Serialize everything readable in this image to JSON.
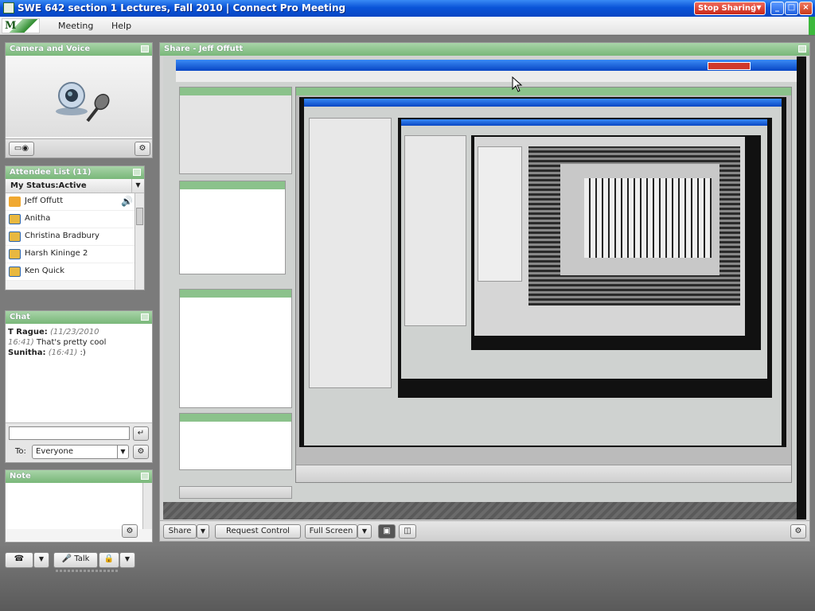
{
  "window": {
    "title": "SWE 642 section 1 Lectures, Fall 2010  |  Connect Pro Meeting",
    "stop_sharing_label": "Stop Sharing",
    "minimize": "_",
    "maximize": "□",
    "close": "×"
  },
  "menu": {
    "logo": "M",
    "items": [
      "Meeting",
      "Help"
    ]
  },
  "camera_pod": {
    "title": "Camera and Voice"
  },
  "attendee_pod": {
    "title": "Attendee List (11)",
    "status_label": "My Status:Active",
    "attendees": [
      {
        "name": "Jeff Offutt",
        "role": "host",
        "speaking": true
      },
      {
        "name": "Anitha",
        "role": "participant"
      },
      {
        "name": "Christina Bradbury",
        "role": "participant"
      },
      {
        "name": "Harsh Kininge 2",
        "role": "participant"
      },
      {
        "name": "Ken Quick",
        "role": "participant"
      }
    ]
  },
  "chat_pod": {
    "title": "Chat",
    "messages": [
      {
        "name": "T Rague:",
        "timestamp": "(11/23/2010",
        "timestamp2": "16:41)",
        "text": "That's pretty cool"
      },
      {
        "name": "Sunitha:",
        "timestamp": "(16:41)",
        "text": ":)"
      }
    ],
    "input_value": "",
    "to_label": "To:",
    "to_value": "Everyone"
  },
  "note_pod": {
    "title": "Note"
  },
  "share_pod": {
    "title": "Share - Jeff Offutt",
    "share_label": "Share",
    "request_control_label": "Request Control",
    "full_screen_label": "Full Screen"
  },
  "bottom_toolbar": {
    "talk_label": "Talk"
  },
  "colors": {
    "titlebar_blue": "#0a54d8",
    "pod_header_green": "#79b779",
    "stop_sharing_red": "#c8281a"
  }
}
